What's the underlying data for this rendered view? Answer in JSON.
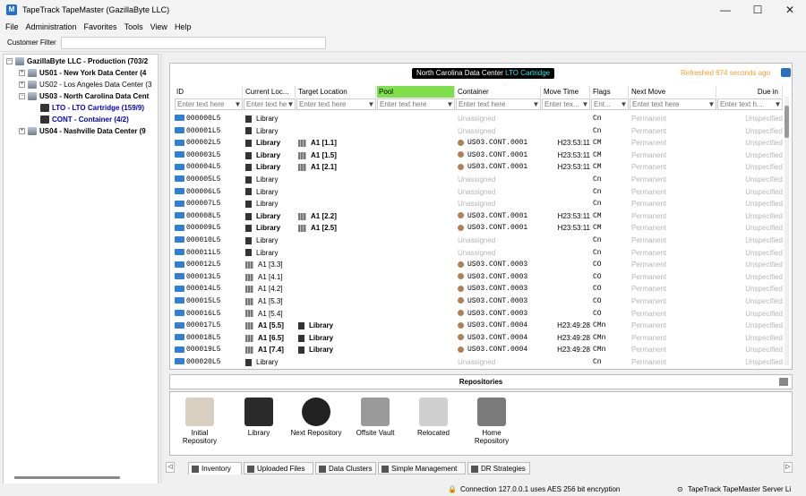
{
  "window": {
    "title": "TapeTrack TapeMaster (GazillaByte LLC)",
    "app_icon": "tapetrack-app-icon"
  },
  "menu": [
    "File",
    "Administration",
    "Favorites",
    "Tools",
    "View",
    "Help"
  ],
  "filter": {
    "label": "Customer Filter",
    "value": ""
  },
  "tree": [
    {
      "label": "GazillaByte LLC - Production (703/2",
      "style": "bold",
      "expander": "−"
    },
    {
      "label": "US01 - New York Data Center (4",
      "style": "bold",
      "expander": "+"
    },
    {
      "label": "US02 - Los Angeles Data Center (3",
      "style": "normal",
      "expander": "+"
    },
    {
      "label": "US03 - North Carolina Data Cent",
      "style": "bold",
      "expander": "−"
    },
    {
      "label": "LTO - LTO Cartridge (159/9)",
      "style": "blue",
      "expander": ""
    },
    {
      "label": "CONT - Container (4/2)",
      "style": "blue",
      "expander": ""
    },
    {
      "label": "US04 - Nashville Data Center (9",
      "style": "bold",
      "expander": "+"
    }
  ],
  "grid": {
    "location_label": "North Carolina Data Center",
    "location_type": "LTO Cartridge",
    "refreshed": "Refreshed 674 seconds ago",
    "columns": [
      "ID",
      "Current Loc...",
      "Target Location",
      "Pool",
      "Container",
      "Move Time",
      "Flags",
      "Next Move",
      "Due in"
    ],
    "filter_placeholders": [
      "Enter text here",
      "Enter text here",
      "Enter text here",
      "Enter text here",
      "Enter text here",
      "Enter tex...",
      "Ent...",
      "Enter text here",
      "Enter text h..."
    ],
    "rows": [
      {
        "id": "000000L5",
        "cur": "Library",
        "tgt": "",
        "container": "Unassigned",
        "time": "",
        "flags": "Cn",
        "next": "Permanent",
        "due": "Unspecified"
      },
      {
        "id": "000001L5",
        "cur": "Library",
        "tgt": "",
        "container": "Unassigned",
        "time": "",
        "flags": "Cn",
        "next": "Permanent",
        "due": "Unspecified"
      },
      {
        "id": "000002L5",
        "cur": "Library",
        "tgt": "A1 [1.1]",
        "container": "US03.CONT.0001",
        "time": "H23:53:11",
        "flags": "CM",
        "next": "Permanent",
        "due": "Unspecified"
      },
      {
        "id": "000003L5",
        "cur": "Library",
        "tgt": "A1 [1.5]",
        "container": "US03.CONT.0001",
        "time": "H23:53:11",
        "flags": "CM",
        "next": "Permanent",
        "due": "Unspecified"
      },
      {
        "id": "000004L5",
        "cur": "Library",
        "tgt": "A1 [2.1]",
        "container": "US03.CONT.0001",
        "time": "H23:53:11",
        "flags": "CM",
        "next": "Permanent",
        "due": "Unspecified"
      },
      {
        "id": "000005L5",
        "cur": "Library",
        "tgt": "",
        "container": "Unassigned",
        "time": "",
        "flags": "Cn",
        "next": "Permanent",
        "due": "Unspecified"
      },
      {
        "id": "000006L5",
        "cur": "Library",
        "tgt": "",
        "container": "Unassigned",
        "time": "",
        "flags": "Cn",
        "next": "Permanent",
        "due": "Unspecified"
      },
      {
        "id": "000007L5",
        "cur": "Library",
        "tgt": "",
        "container": "Unassigned",
        "time": "",
        "flags": "Cn",
        "next": "Permanent",
        "due": "Unspecified"
      },
      {
        "id": "000008L5",
        "cur": "Library",
        "tgt": "A1 [2.2]",
        "container": "US03.CONT.0001",
        "time": "H23:53:11",
        "flags": "CM",
        "next": "Permanent",
        "due": "Unspecified"
      },
      {
        "id": "000009L5",
        "cur": "Library",
        "tgt": "A1 [2.5]",
        "container": "US03.CONT.0001",
        "time": "H23:53:11",
        "flags": "CM",
        "next": "Permanent",
        "due": "Unspecified"
      },
      {
        "id": "000010L5",
        "cur": "Library",
        "tgt": "",
        "container": "Unassigned",
        "time": "",
        "flags": "Cn",
        "next": "Permanent",
        "due": "Unspecified"
      },
      {
        "id": "000011L5",
        "cur": "Library",
        "tgt": "",
        "container": "Unassigned",
        "time": "",
        "flags": "Cn",
        "next": "Permanent",
        "due": "Unspecified"
      },
      {
        "id": "000012L5",
        "cur": "A1 [3.3]",
        "tgt": "",
        "container": "US03.CONT.0003",
        "time": "",
        "flags": "CO",
        "next": "Permanent",
        "due": "Unspecified"
      },
      {
        "id": "000013L5",
        "cur": "A1 [4.1]",
        "tgt": "",
        "container": "US03.CONT.0003",
        "time": "",
        "flags": "CO",
        "next": "Permanent",
        "due": "Unspecified"
      },
      {
        "id": "000014L5",
        "cur": "A1 [4.2]",
        "tgt": "",
        "container": "US03.CONT.0003",
        "time": "",
        "flags": "CO",
        "next": "Permanent",
        "due": "Unspecified"
      },
      {
        "id": "000015L5",
        "cur": "A1 [5.3]",
        "tgt": "",
        "container": "US03.CONT.0003",
        "time": "",
        "flags": "CO",
        "next": "Permanent",
        "due": "Unspecified"
      },
      {
        "id": "000016L5",
        "cur": "A1 [5.4]",
        "tgt": "",
        "container": "US03.CONT.0003",
        "time": "",
        "flags": "CO",
        "next": "Permanent",
        "due": "Unspecified"
      },
      {
        "id": "000017L5",
        "cur": "A1 [5.5]",
        "tgt": "Library",
        "container": "US03.CONT.0004",
        "time": "H23:49:28",
        "flags": "CMn",
        "next": "Permanent",
        "due": "Unspecified"
      },
      {
        "id": "000018L5",
        "cur": "A1 [6.5]",
        "tgt": "Library",
        "container": "US03.CONT.0004",
        "time": "H23:49:28",
        "flags": "CMn",
        "next": "Permanent",
        "due": "Unspecified"
      },
      {
        "id": "000019L5",
        "cur": "A1 [7.4]",
        "tgt": "Library",
        "container": "US03.CONT.0004",
        "time": "H23:49:28",
        "flags": "CMn",
        "next": "Permanent",
        "due": "Unspecified"
      },
      {
        "id": "000020L5",
        "cur": "Library",
        "tgt": "",
        "container": "Unassigned",
        "time": "",
        "flags": "Cn",
        "next": "Permanent",
        "due": "Unspecified"
      }
    ]
  },
  "repositories": {
    "title": "Repositories",
    "items": [
      {
        "label": "Initial\nRepository",
        "icon": "initial-repository-icon",
        "color": "#d8cfc0"
      },
      {
        "label": "Library",
        "icon": "library-icon",
        "color": "#2b2b2b"
      },
      {
        "label": "Next Repository",
        "icon": "next-repository-icon",
        "color": "#222222"
      },
      {
        "label": "Offsite Vault",
        "icon": "offsite-vault-icon",
        "color": "#9a9a9a"
      },
      {
        "label": "Relocated",
        "icon": "relocated-icon",
        "color": "#cfcfcf"
      },
      {
        "label": "Home\nRepository",
        "icon": "home-repository-icon",
        "color": "#7a7a7a"
      }
    ]
  },
  "tabs": [
    {
      "label": "Inventory",
      "active": true,
      "icon": "inventory-icon"
    },
    {
      "label": "Uploaded Files",
      "active": false,
      "icon": "uploaded-files-icon"
    },
    {
      "label": "Data Clusters",
      "active": false,
      "icon": "data-clusters-icon"
    },
    {
      "label": "Simple Management",
      "active": false,
      "icon": "simple-management-icon"
    },
    {
      "label": "DR Strategies",
      "active": false,
      "icon": "dr-strategies-icon"
    }
  ],
  "status": {
    "connection": "Connection 127.0.0.1 uses AES 256 bit encryption",
    "server": "TapeTrack TapeMaster Server Li"
  },
  "colors": {
    "pool_header": "#7de04b",
    "location_accent": "#31e0e6",
    "refreshed": "#f0a030",
    "tree_link": "#0000cc"
  }
}
